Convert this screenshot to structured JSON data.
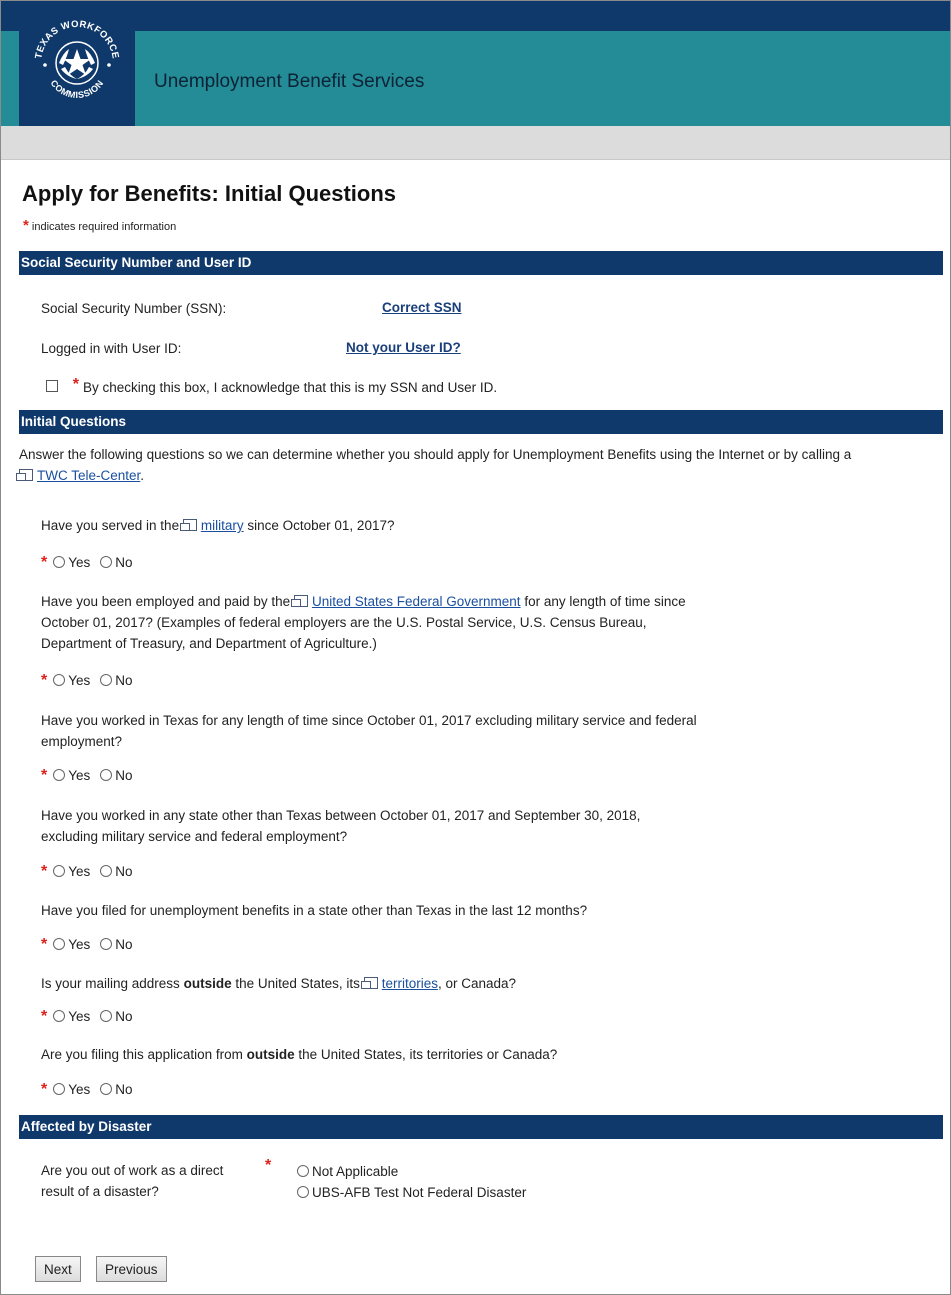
{
  "header": {
    "app_title": "Unemployment Benefit Services",
    "logo_text_top": "TEXAS WORKFORCE",
    "logo_text_bottom": "COMMISSION",
    "brand_navy": "#10396b",
    "brand_teal": "#248c96"
  },
  "page": {
    "title": "Apply for Benefits: Initial Questions",
    "required_marker": "*",
    "required_note": "indicates required information"
  },
  "ssn_section": {
    "heading": "Social Security Number and User ID",
    "ssn_label": "Social Security Number (SSN):",
    "ssn_link": "Correct SSN",
    "userid_label": "Logged in with User ID:",
    "userid_link": "Not your User ID?",
    "ack_text": "By checking this box, I acknowledge that this is my SSN and User ID.",
    "ack_checked": false
  },
  "initial_section": {
    "heading": "Initial Questions",
    "intro_pre": "Answer the following questions so we can determine whether you should apply for Unemployment Benefits using the Internet or by calling a",
    "intro_link": "TWC Tele-Center",
    "intro_post": ".",
    "yes_label": "Yes",
    "no_label": "No",
    "q1_pre": "Have you served in the",
    "q1_link": "military",
    "q1_post": "since October 01, 2017?",
    "q2_pre": "Have you been employed and paid by the",
    "q2_link": "United States Federal Government",
    "q2_post": "for any length of time since",
    "q2_line2": "October 01, 2017? (Examples of federal employers are the U.S. Postal Service, U.S. Census Bureau,",
    "q2_line3": "Department of Treasury, and Department of Agriculture.)",
    "q3_line1": "Have you worked in Texas for any length of time since October 01, 2017 excluding military service and federal",
    "q3_line2": "employment?",
    "q4_line1": "Have you worked in any state other than Texas between October 01, 2017 and September 30, 2018,",
    "q4_line2": "excluding military service and federal employment?",
    "q5": "Have you filed for unemployment benefits in a state other than Texas in the last 12 months?",
    "q6_pre": "Is your mailing address",
    "q6_bold": "outside",
    "q6_mid": "the United States, its",
    "q6_link": "territories",
    "q6_post": ", or Canada?",
    "q7_pre": "Are you filing this application from",
    "q7_bold": "outside",
    "q7_post": "the United States, its territories or Canada?"
  },
  "disaster_section": {
    "heading": "Affected by Disaster",
    "question_line1": "Are you out of work as a direct",
    "question_line2": "result of a disaster?",
    "options": [
      "Not Applicable",
      "UBS-AFB Test Not Federal Disaster"
    ]
  },
  "buttons": {
    "next": "Next",
    "previous": "Previous"
  }
}
